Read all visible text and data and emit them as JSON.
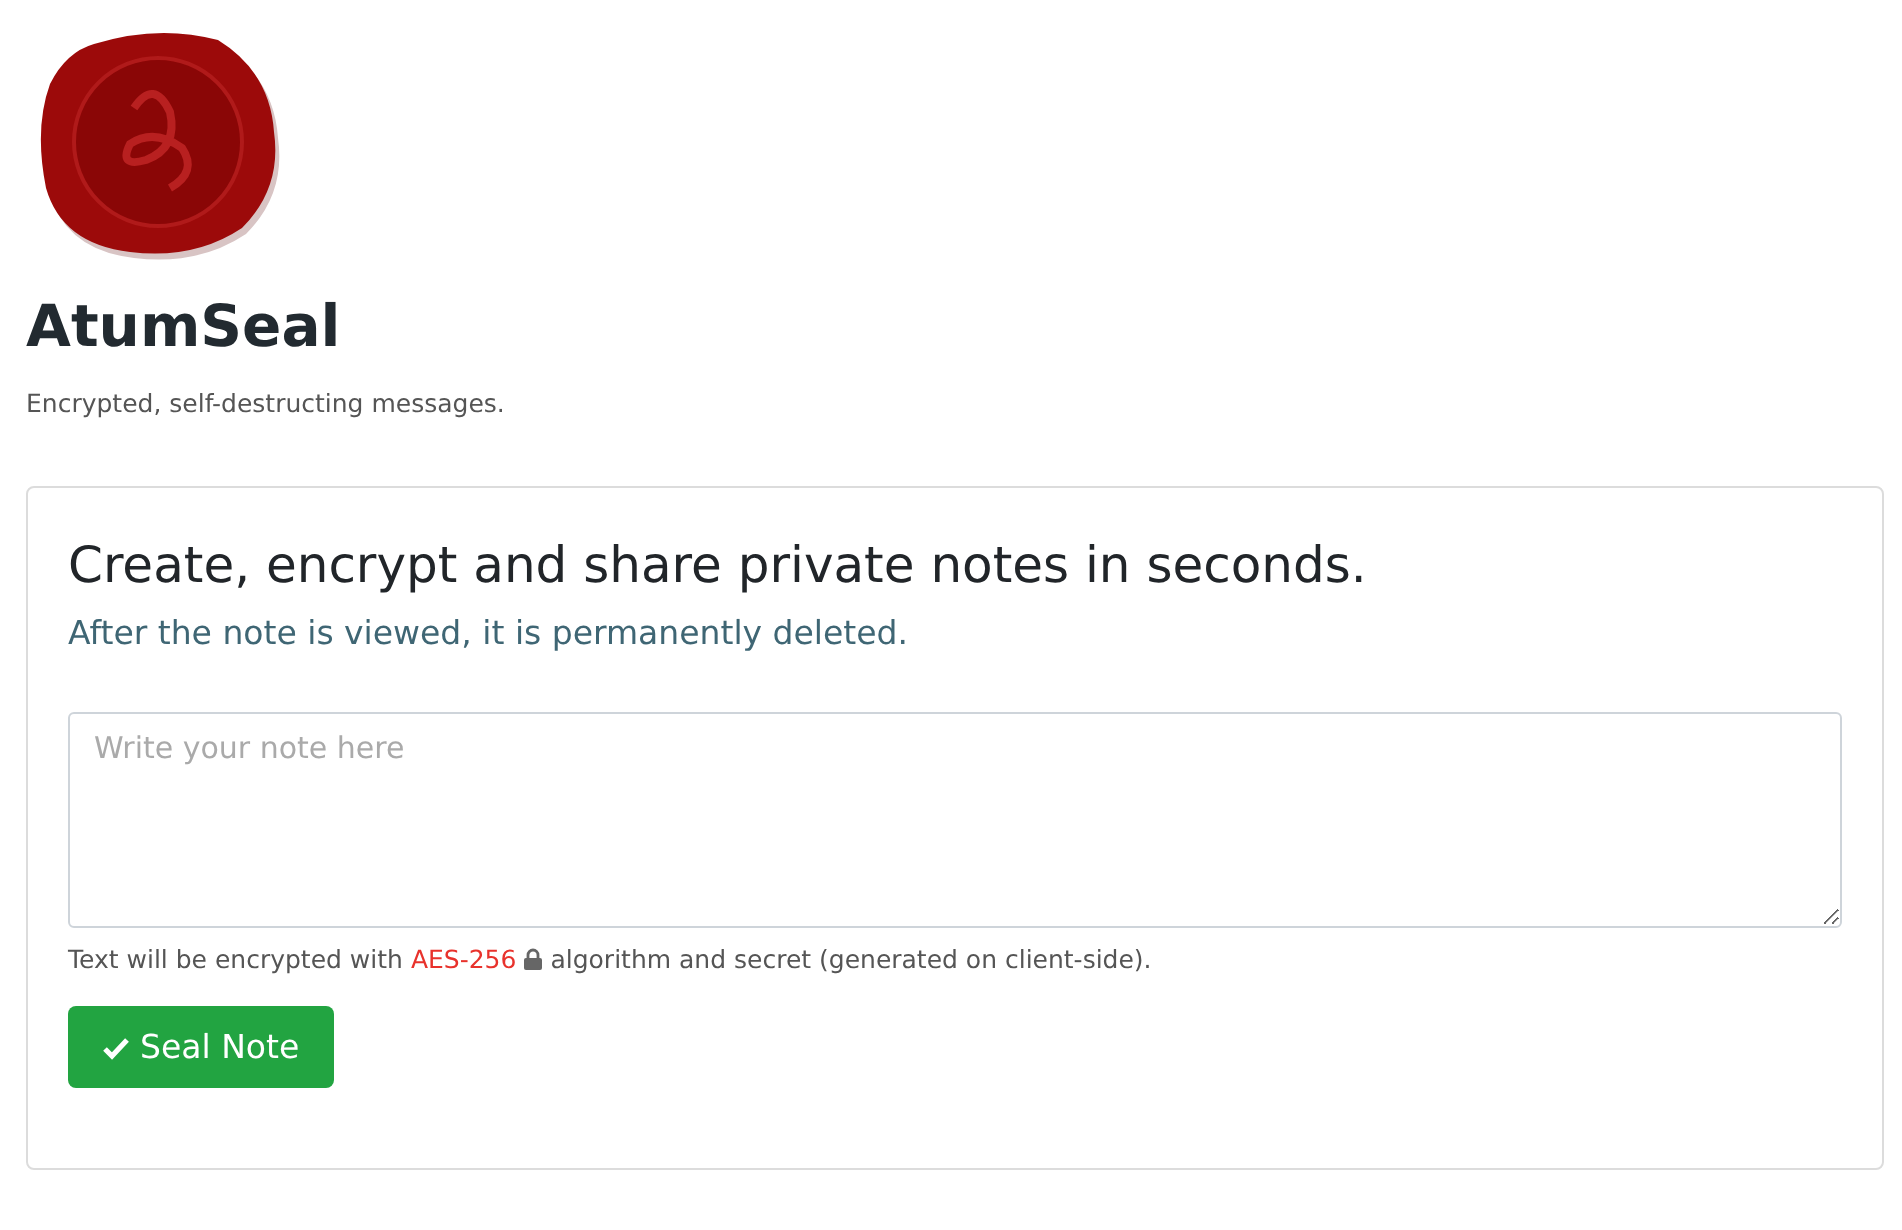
{
  "brand": {
    "name": "AtumSeal",
    "tagline": "Encrypted, self-destructing messages."
  },
  "card": {
    "heading": "Create, encrypt and share private notes in seconds.",
    "subheading": "After the note is viewed, it is permanently deleted.",
    "note_field": {
      "placeholder": "Write your note here"
    },
    "helper": {
      "before": "Text will be encrypted with",
      "algorithm": "AES-256",
      "after": "algorithm and secret (generated on client-side)."
    },
    "button": "Seal Note"
  }
}
